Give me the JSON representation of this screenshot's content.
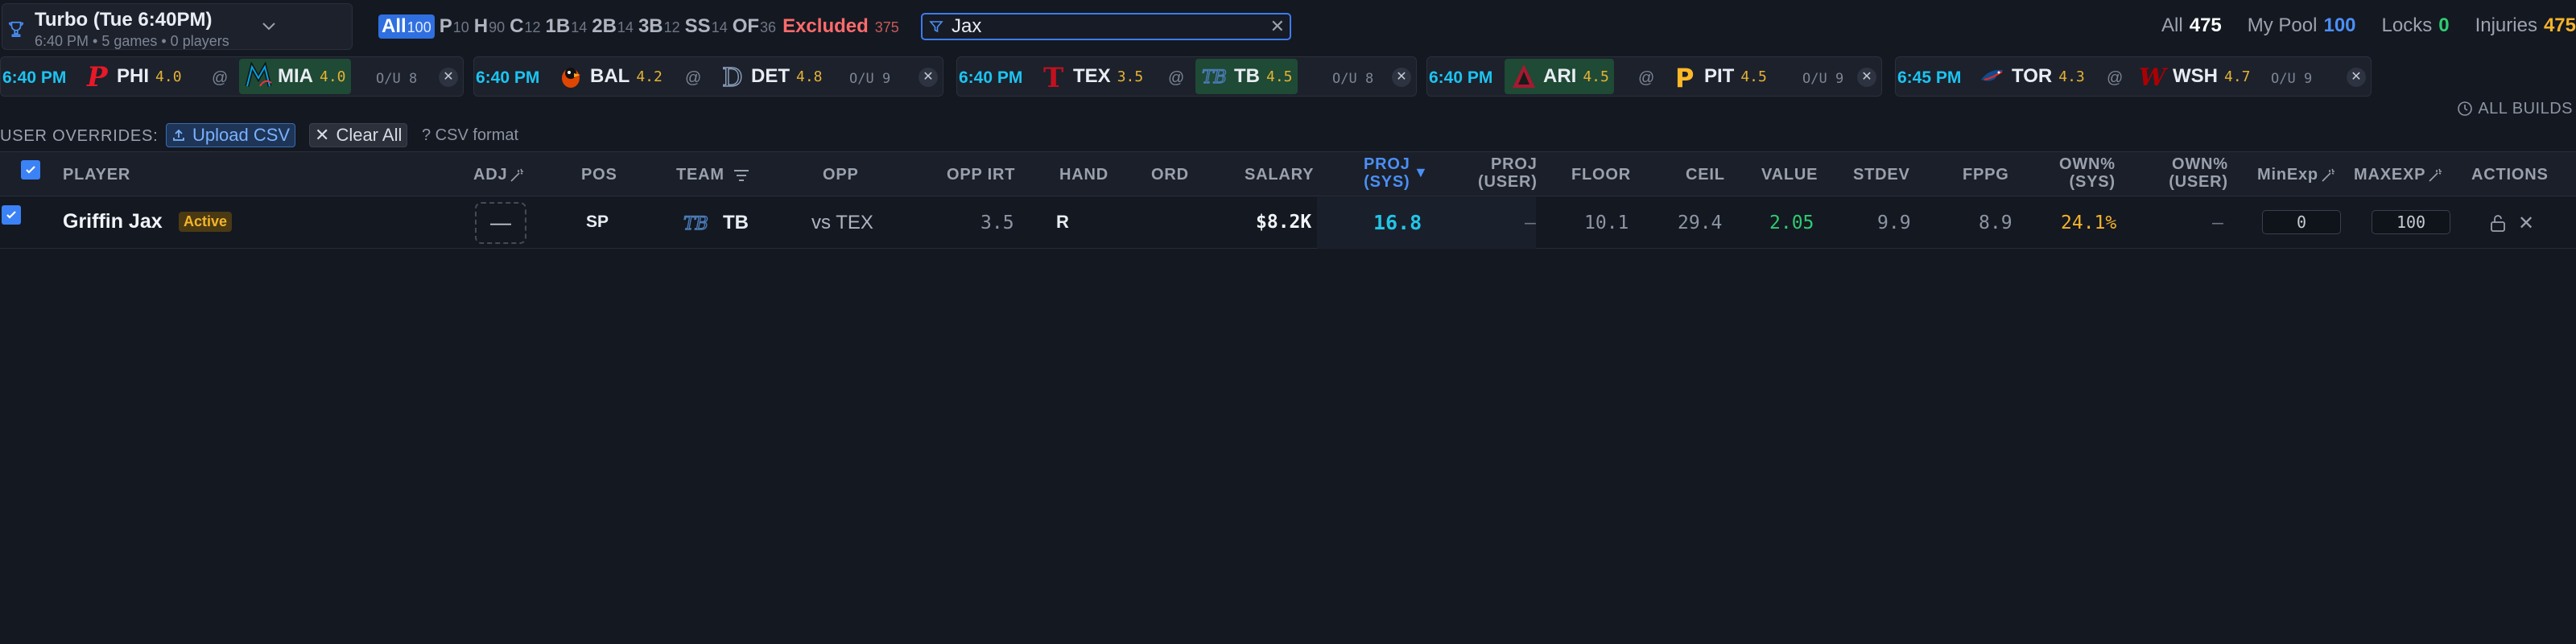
{
  "slate": {
    "name": "Turbo (Tue 6:40PM)",
    "subtitle": "6:40 PM • 5 games • 0 players"
  },
  "positions": [
    {
      "label": "All",
      "count": "100",
      "active": true
    },
    {
      "label": "P",
      "count": "10"
    },
    {
      "label": "H",
      "count": "90"
    },
    {
      "label": "C",
      "count": "12"
    },
    {
      "label": "1B",
      "count": "14"
    },
    {
      "label": "2B",
      "count": "14"
    },
    {
      "label": "3B",
      "count": "12"
    },
    {
      "label": "SS",
      "count": "14"
    },
    {
      "label": "OF",
      "count": "36"
    },
    {
      "label": "Excluded",
      "count": "375",
      "excluded": true
    }
  ],
  "search": {
    "value": "Jax"
  },
  "counts": {
    "all_label": "All",
    "all_value": "475",
    "pool_label": "My Pool",
    "pool_value": "100",
    "locks_label": "Locks",
    "locks_value": "0",
    "injuries_label": "Injuries",
    "injuries_value": "475"
  },
  "games": [
    {
      "time": "6:40 PM",
      "away": {
        "abbr": "PHI",
        "irt": "4.0",
        "logo": "phi-logo"
      },
      "home": {
        "abbr": "MIA",
        "irt": "4.0",
        "logo": "mia-logo",
        "fav": true
      },
      "ou": "O/U 8"
    },
    {
      "time": "6:40 PM",
      "away": {
        "abbr": "BAL",
        "irt": "4.2",
        "logo": "bal-logo"
      },
      "home": {
        "abbr": "DET",
        "irt": "4.8",
        "logo": "det-logo"
      },
      "ou": "O/U 9"
    },
    {
      "time": "6:40 PM",
      "away": {
        "abbr": "TEX",
        "irt": "3.5",
        "logo": "tex-logo"
      },
      "home": {
        "abbr": "TB",
        "irt": "4.5",
        "logo": "tb-logo",
        "fav": true
      },
      "ou": "O/U 8"
    },
    {
      "time": "6:40 PM",
      "away": {
        "abbr": "ARI",
        "irt": "4.5",
        "logo": "ari-logo",
        "fav": true
      },
      "home": {
        "abbr": "PIT",
        "irt": "4.5",
        "logo": "pit-logo"
      },
      "ou": "O/U 9"
    },
    {
      "time": "6:45 PM",
      "away": {
        "abbr": "TOR",
        "irt": "4.3",
        "logo": "tor-logo"
      },
      "home": {
        "abbr": "WSH",
        "irt": "4.7",
        "logo": "wsh-logo"
      },
      "ou": "O/U 9"
    }
  ],
  "games_at": "@",
  "all_builds": "ALL BUILDS",
  "overrides": {
    "label": "USER OVERRIDES:",
    "upload": "Upload CSV",
    "clear": "Clear All",
    "help": "? CSV format"
  },
  "columns": {
    "player": "PLAYER",
    "adj": "ADJ",
    "pos": "POS",
    "team": "TEAM",
    "opp": "OPP",
    "opp_irt": "OPP IRT",
    "hand": "HAND",
    "ord": "ORD",
    "salary": "SALARY",
    "proj_sys_1": "PROJ",
    "proj_sys_2": "(SYS)",
    "proj_user_1": "PROJ",
    "proj_user_2": "(USER)",
    "floor": "FLOOR",
    "ceil": "CEIL",
    "value": "VALUE",
    "stdev": "STDEV",
    "fppg": "FPPG",
    "own_sys_1": "OWN%",
    "own_sys_2": "(SYS)",
    "own_user_1": "OWN%",
    "own_user_2": "(USER)",
    "minexp": "MinExp",
    "maxexp": "MAXEXP",
    "actions": "ACTIONS"
  },
  "rows": [
    {
      "player": "Griffin Jax",
      "status": "Active",
      "adj": "—",
      "pos": "SP",
      "team": "TB",
      "opp": "vs TEX",
      "opp_irt": "3.5",
      "hand": "R",
      "ord": "",
      "salary": "$8.2K",
      "proj_sys": "16.8",
      "proj_user": "—",
      "floor": "10.1",
      "ceil": "29.4",
      "value": "2.05",
      "stdev": "9.9",
      "fppg": "8.9",
      "own_sys": "24.1%",
      "own_user": "—",
      "minexp": "0",
      "maxexp": "100"
    }
  ],
  "colors": {
    "accent": "#3b82f6",
    "time": "#1cc4f0",
    "irt": "#e5b233",
    "proj": "#22c5e8",
    "value": "#2ecc71",
    "own": "#f4b42a",
    "excluded": "#ff6b6b"
  }
}
